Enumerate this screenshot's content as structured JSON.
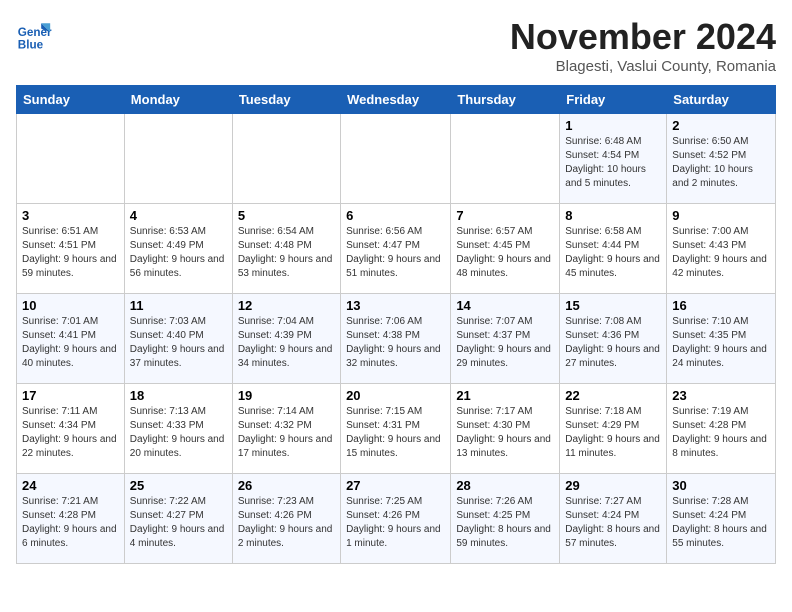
{
  "logo": {
    "text_general": "General",
    "text_blue": "Blue"
  },
  "header": {
    "month_year": "November 2024",
    "location": "Blagesti, Vaslui County, Romania"
  },
  "weekdays": [
    "Sunday",
    "Monday",
    "Tuesday",
    "Wednesday",
    "Thursday",
    "Friday",
    "Saturday"
  ],
  "weeks": [
    [
      {
        "day": "",
        "sunrise": "",
        "sunset": "",
        "daylight": ""
      },
      {
        "day": "",
        "sunrise": "",
        "sunset": "",
        "daylight": ""
      },
      {
        "day": "",
        "sunrise": "",
        "sunset": "",
        "daylight": ""
      },
      {
        "day": "",
        "sunrise": "",
        "sunset": "",
        "daylight": ""
      },
      {
        "day": "",
        "sunrise": "",
        "sunset": "",
        "daylight": ""
      },
      {
        "day": "1",
        "sunrise": "Sunrise: 6:48 AM",
        "sunset": "Sunset: 4:54 PM",
        "daylight": "Daylight: 10 hours and 5 minutes."
      },
      {
        "day": "2",
        "sunrise": "Sunrise: 6:50 AM",
        "sunset": "Sunset: 4:52 PM",
        "daylight": "Daylight: 10 hours and 2 minutes."
      }
    ],
    [
      {
        "day": "3",
        "sunrise": "Sunrise: 6:51 AM",
        "sunset": "Sunset: 4:51 PM",
        "daylight": "Daylight: 9 hours and 59 minutes."
      },
      {
        "day": "4",
        "sunrise": "Sunrise: 6:53 AM",
        "sunset": "Sunset: 4:49 PM",
        "daylight": "Daylight: 9 hours and 56 minutes."
      },
      {
        "day": "5",
        "sunrise": "Sunrise: 6:54 AM",
        "sunset": "Sunset: 4:48 PM",
        "daylight": "Daylight: 9 hours and 53 minutes."
      },
      {
        "day": "6",
        "sunrise": "Sunrise: 6:56 AM",
        "sunset": "Sunset: 4:47 PM",
        "daylight": "Daylight: 9 hours and 51 minutes."
      },
      {
        "day": "7",
        "sunrise": "Sunrise: 6:57 AM",
        "sunset": "Sunset: 4:45 PM",
        "daylight": "Daylight: 9 hours and 48 minutes."
      },
      {
        "day": "8",
        "sunrise": "Sunrise: 6:58 AM",
        "sunset": "Sunset: 4:44 PM",
        "daylight": "Daylight: 9 hours and 45 minutes."
      },
      {
        "day": "9",
        "sunrise": "Sunrise: 7:00 AM",
        "sunset": "Sunset: 4:43 PM",
        "daylight": "Daylight: 9 hours and 42 minutes."
      }
    ],
    [
      {
        "day": "10",
        "sunrise": "Sunrise: 7:01 AM",
        "sunset": "Sunset: 4:41 PM",
        "daylight": "Daylight: 9 hours and 40 minutes."
      },
      {
        "day": "11",
        "sunrise": "Sunrise: 7:03 AM",
        "sunset": "Sunset: 4:40 PM",
        "daylight": "Daylight: 9 hours and 37 minutes."
      },
      {
        "day": "12",
        "sunrise": "Sunrise: 7:04 AM",
        "sunset": "Sunset: 4:39 PM",
        "daylight": "Daylight: 9 hours and 34 minutes."
      },
      {
        "day": "13",
        "sunrise": "Sunrise: 7:06 AM",
        "sunset": "Sunset: 4:38 PM",
        "daylight": "Daylight: 9 hours and 32 minutes."
      },
      {
        "day": "14",
        "sunrise": "Sunrise: 7:07 AM",
        "sunset": "Sunset: 4:37 PM",
        "daylight": "Daylight: 9 hours and 29 minutes."
      },
      {
        "day": "15",
        "sunrise": "Sunrise: 7:08 AM",
        "sunset": "Sunset: 4:36 PM",
        "daylight": "Daylight: 9 hours and 27 minutes."
      },
      {
        "day": "16",
        "sunrise": "Sunrise: 7:10 AM",
        "sunset": "Sunset: 4:35 PM",
        "daylight": "Daylight: 9 hours and 24 minutes."
      }
    ],
    [
      {
        "day": "17",
        "sunrise": "Sunrise: 7:11 AM",
        "sunset": "Sunset: 4:34 PM",
        "daylight": "Daylight: 9 hours and 22 minutes."
      },
      {
        "day": "18",
        "sunrise": "Sunrise: 7:13 AM",
        "sunset": "Sunset: 4:33 PM",
        "daylight": "Daylight: 9 hours and 20 minutes."
      },
      {
        "day": "19",
        "sunrise": "Sunrise: 7:14 AM",
        "sunset": "Sunset: 4:32 PM",
        "daylight": "Daylight: 9 hours and 17 minutes."
      },
      {
        "day": "20",
        "sunrise": "Sunrise: 7:15 AM",
        "sunset": "Sunset: 4:31 PM",
        "daylight": "Daylight: 9 hours and 15 minutes."
      },
      {
        "day": "21",
        "sunrise": "Sunrise: 7:17 AM",
        "sunset": "Sunset: 4:30 PM",
        "daylight": "Daylight: 9 hours and 13 minutes."
      },
      {
        "day": "22",
        "sunrise": "Sunrise: 7:18 AM",
        "sunset": "Sunset: 4:29 PM",
        "daylight": "Daylight: 9 hours and 11 minutes."
      },
      {
        "day": "23",
        "sunrise": "Sunrise: 7:19 AM",
        "sunset": "Sunset: 4:28 PM",
        "daylight": "Daylight: 9 hours and 8 minutes."
      }
    ],
    [
      {
        "day": "24",
        "sunrise": "Sunrise: 7:21 AM",
        "sunset": "Sunset: 4:28 PM",
        "daylight": "Daylight: 9 hours and 6 minutes."
      },
      {
        "day": "25",
        "sunrise": "Sunrise: 7:22 AM",
        "sunset": "Sunset: 4:27 PM",
        "daylight": "Daylight: 9 hours and 4 minutes."
      },
      {
        "day": "26",
        "sunrise": "Sunrise: 7:23 AM",
        "sunset": "Sunset: 4:26 PM",
        "daylight": "Daylight: 9 hours and 2 minutes."
      },
      {
        "day": "27",
        "sunrise": "Sunrise: 7:25 AM",
        "sunset": "Sunset: 4:26 PM",
        "daylight": "Daylight: 9 hours and 1 minute."
      },
      {
        "day": "28",
        "sunrise": "Sunrise: 7:26 AM",
        "sunset": "Sunset: 4:25 PM",
        "daylight": "Daylight: 8 hours and 59 minutes."
      },
      {
        "day": "29",
        "sunrise": "Sunrise: 7:27 AM",
        "sunset": "Sunset: 4:24 PM",
        "daylight": "Daylight: 8 hours and 57 minutes."
      },
      {
        "day": "30",
        "sunrise": "Sunrise: 7:28 AM",
        "sunset": "Sunset: 4:24 PM",
        "daylight": "Daylight: 8 hours and 55 minutes."
      }
    ]
  ]
}
